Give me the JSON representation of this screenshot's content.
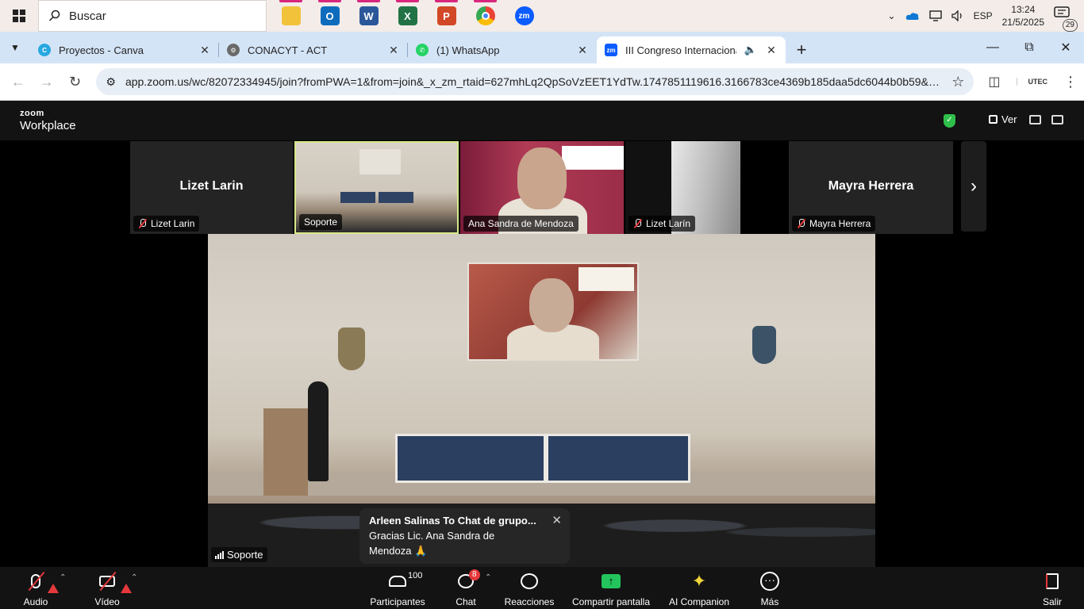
{
  "taskbar": {
    "search_placeholder": "Buscar",
    "pinned": [
      "file-explorer",
      "outlook",
      "word",
      "excel",
      "powerpoint",
      "chrome",
      "zoom"
    ],
    "tray": {
      "language": "ESP",
      "time": "13:24",
      "date": "21/5/2025",
      "notifications": "29"
    }
  },
  "browser": {
    "tabs": [
      {
        "title": "Proyectos - Canva",
        "favicon_color": "#27a8e0"
      },
      {
        "title": "CONACYT - ACT",
        "favicon_color": "#6a6a6a"
      },
      {
        "title": "(1) WhatsApp",
        "favicon_color": "#25d366"
      },
      {
        "title": "III Congreso Internacional P",
        "favicon_color": "#0b5cff"
      }
    ],
    "url": "app.zoom.us/wc/82072334945/join?fromPWA=1&from=join&_x_zm_rtaid=627mhLq2QpSoVzEET1YdTw.1747851119616.3166783ce4369b185daa5dc6044b0b59&_x_...",
    "extension_label": "UTEC"
  },
  "zoom": {
    "brand_top": "zoom",
    "brand_bottom": "Workplace",
    "view_label": "Ver",
    "participants_strip": [
      {
        "name": "Lizet Larin",
        "label": "Lizet Larin",
        "muted": true
      },
      {
        "name": "",
        "label": "Soporte",
        "muted": false
      },
      {
        "name": "",
        "label": "Ana Sandra de Mendoza",
        "muted": false
      },
      {
        "name": "",
        "label": "Lizet Larín",
        "muted": true
      },
      {
        "name": "Mayra Herrera",
        "label": "Mayra Herrera",
        "muted": true
      }
    ],
    "main_speaker_label": "Soporte",
    "chat_popup": {
      "sender": "Arleen Salinas To Chat de grupo...",
      "message": "Gracias Lic. Ana Sandra de Mendoza 🙏"
    },
    "controls": {
      "audio": "Audio",
      "video": "Vídeo",
      "participants": "Participantes",
      "participants_count": "100",
      "chat": "Chat",
      "chat_badge": "8",
      "reactions": "Reacciones",
      "share": "Compartir pantalla",
      "ai": "AI Companion",
      "more": "Más",
      "leave": "Salir"
    },
    "colors": {
      "accent_green": "#23c45d",
      "alert_red": "#e5383b",
      "selected_tile": "#d7e88a"
    }
  }
}
